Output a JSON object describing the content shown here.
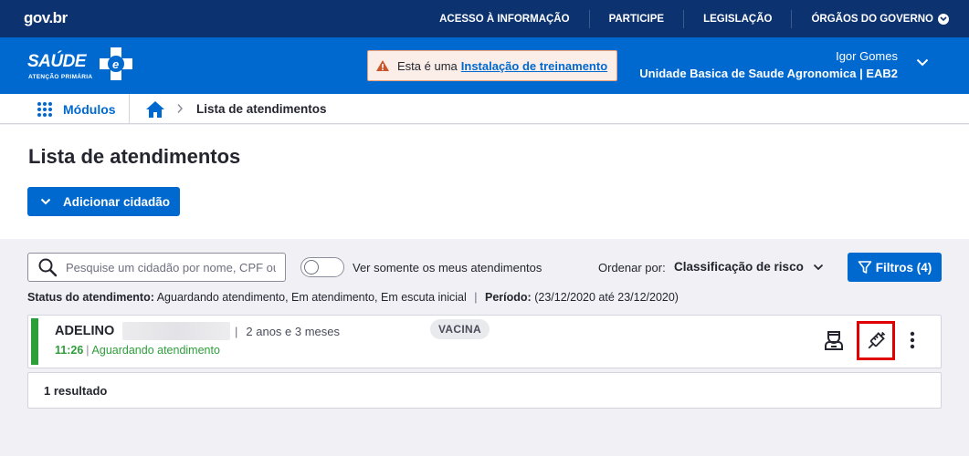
{
  "gov": {
    "logo": "gov.br",
    "nav": [
      "ACESSO À INFORMAÇÃO",
      "PARTICIPE",
      "LEGISLAÇÃO",
      "ÓRGÃOS DO GOVERNO"
    ]
  },
  "header": {
    "brand": "SAÚDE",
    "brand_sub": "ATENÇÃO PRIMÁRIA",
    "brand_badge": "e-SUS",
    "training_prefix": "Esta é uma",
    "training_link": "Instalação de treinamento",
    "user_name": "Igor Gomes",
    "user_unit": "Unidade Basica de Saude Agronomica | EAB2"
  },
  "breadcrumb": {
    "modules": "Módulos",
    "current": "Lista de atendimentos"
  },
  "page": {
    "title": "Lista de atendimentos",
    "add_button": "Adicionar cidadão"
  },
  "filters": {
    "search_placeholder": "Pesquise um cidadão por nome, CPF ou CNS",
    "toggle_label": "Ver somente os meus atendimentos",
    "sort_label": "Ordenar por:",
    "sort_value": "Classificação de risco",
    "filters_button": "Filtros (4)"
  },
  "status": {
    "status_label": "Status do atendimento:",
    "status_value": "Aguardando atendimento, Em atendimento, Em escuta inicial",
    "period_label": "Período:",
    "period_value": "(23/12/2020 até 23/12/2020)"
  },
  "attendances": [
    {
      "name": "ADELINO",
      "age": "2 anos e 3 meses",
      "time": "11:26",
      "status": "Aguardando atendimento",
      "tag": "VACINA",
      "status_color": "#2e9e3a"
    }
  ],
  "results": "1 resultado",
  "colors": {
    "gov_bar": "#0c326f",
    "primary": "#0069d0",
    "highlight": "#e00000"
  }
}
